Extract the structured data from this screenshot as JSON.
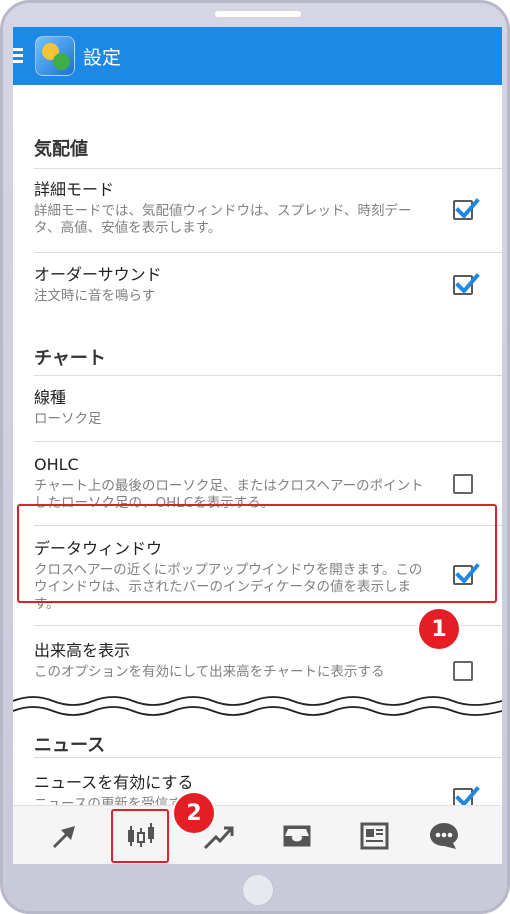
{
  "appbar": {
    "title": "設定"
  },
  "sections": {
    "quotes": {
      "header": "気配値"
    },
    "chart": {
      "header": "チャート"
    },
    "news": {
      "header": "ニュース"
    }
  },
  "settings": {
    "detail_mode": {
      "title": "詳細モード",
      "desc": "詳細モードでは、気配値ウィンドウは、スプレッド、時刻データ、高値、安値を表示します。",
      "checked": true
    },
    "order_sound": {
      "title": "オーダーサウンド",
      "desc": "注文時に音を鳴らす",
      "checked": true
    },
    "line_type": {
      "title": "線種",
      "desc": "ローソク足"
    },
    "ohlc": {
      "title": "OHLC",
      "desc": "チャート上の最後のローソク足、またはクロスヘアーのポイントしたローソク足の、OHLCを表示する。",
      "checked": false
    },
    "data_window": {
      "title": "データウィンドウ",
      "desc": "クロスヘアーの近くにポップアップウインドウを開きます。このウインドウは、示されたバーのインディケータの値を表示します。",
      "checked": true
    },
    "show_volume": {
      "title": "出来高を表示",
      "desc": "このオプションを有効にして出来高をチャートに表示する",
      "checked": false
    },
    "enable_news": {
      "title": "ニュースを有効にする",
      "desc": "ニュースの更新を受信する",
      "checked": true
    }
  },
  "badges": {
    "one": "1",
    "two": "2"
  },
  "nav": [
    {
      "icon": "trade-arrows-icon"
    },
    {
      "icon": "candlestick-chart-icon"
    },
    {
      "icon": "trend-chart-icon"
    },
    {
      "icon": "inbox-icon"
    },
    {
      "icon": "news-icon"
    },
    {
      "icon": "chat-icon"
    }
  ],
  "colors": {
    "appbar": "#1e88e5",
    "accent": "#1e88e5",
    "highlight": "#e0202a",
    "badge": "#e31e24"
  }
}
